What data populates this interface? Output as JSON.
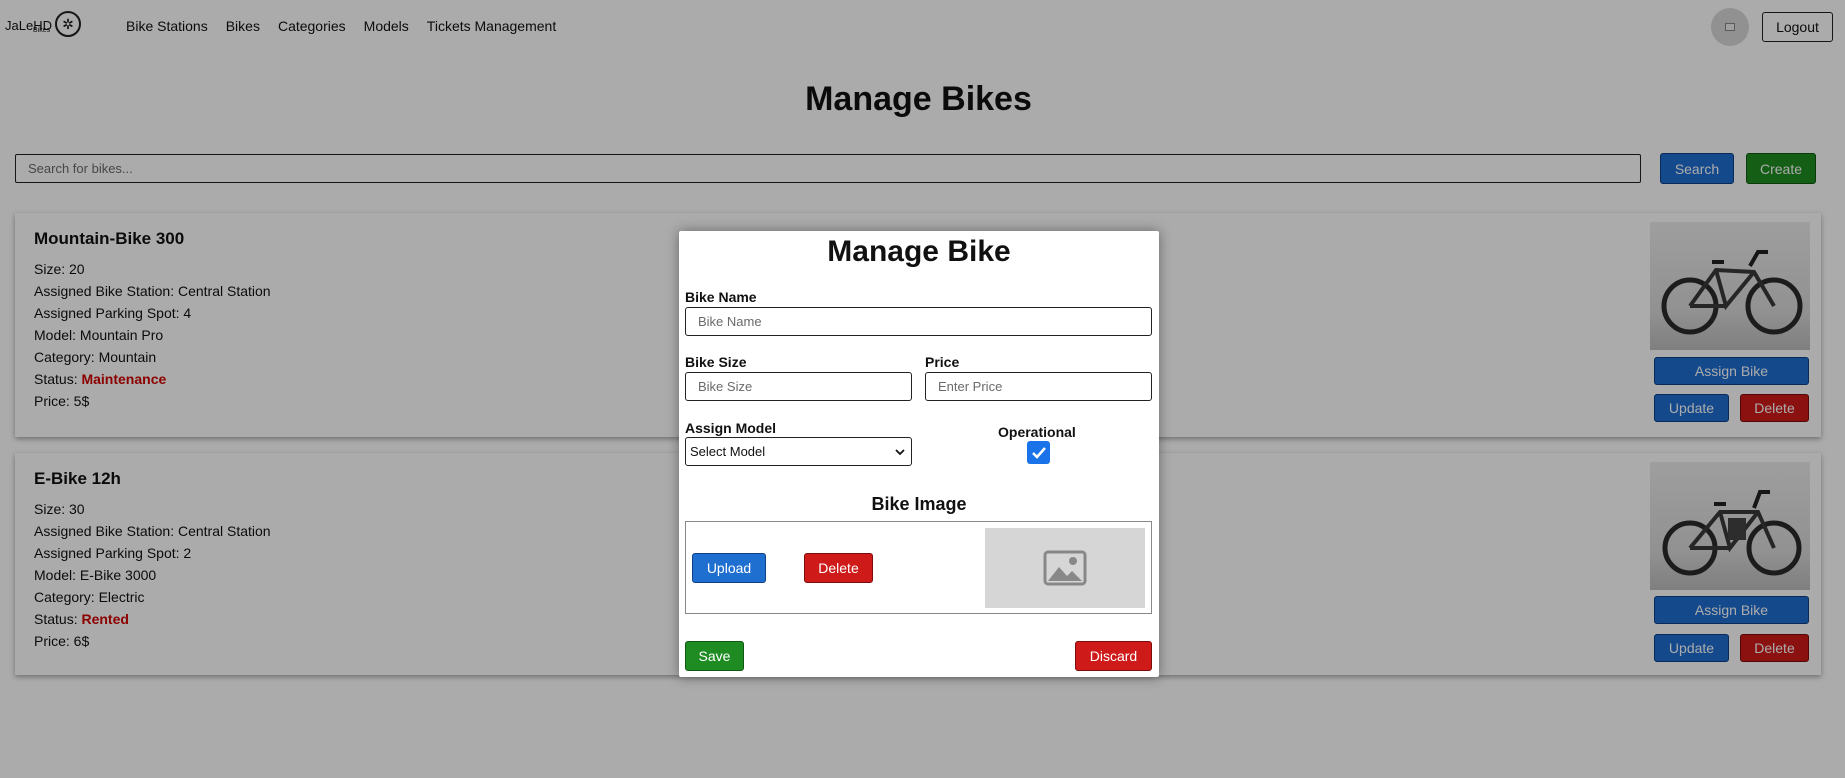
{
  "nav": {
    "logo_text": "JaLeHD",
    "logo_sub": "Bikes",
    "links": [
      "Bike Stations",
      "Bikes",
      "Categories",
      "Models",
      "Tickets Management"
    ],
    "logout": "Logout"
  },
  "page": {
    "title": "Manage Bikes",
    "search_placeholder": "Search for bikes...",
    "search_button": "Search",
    "create_button": "Create"
  },
  "bikes": [
    {
      "name": "Mountain-Bike 300",
      "size": "Size: 20",
      "station": "Assigned Bike Station: Central Station",
      "spot": "Assigned Parking Spot: 4",
      "model": "Model: Mountain Pro",
      "category": "Category: Mountain",
      "status_label": "Status: ",
      "status": "Maintenance",
      "price": "Price: 5$",
      "assign_button": "Assign Bike",
      "update_button": "Update",
      "delete_button": "Delete"
    },
    {
      "name": "E-Bike 12h",
      "size": "Size: 30",
      "station": "Assigned Bike Station: Central Station",
      "spot": "Assigned Parking Spot: 2",
      "model": "Model: E-Bike 3000",
      "category": "Category: Electric",
      "status_label": "Status: ",
      "status": "Rented",
      "price": "Price: 6$",
      "assign_button": "Assign Bike",
      "update_button": "Update",
      "delete_button": "Delete"
    }
  ],
  "modal": {
    "title": "Manage Bike",
    "bike_name_label": "Bike Name",
    "bike_name_placeholder": "Bike Name",
    "bike_size_label": "Bike Size",
    "bike_size_placeholder": "Bike Size",
    "price_label": "Price",
    "price_placeholder": "Enter Price",
    "assign_model_label": "Assign Model",
    "model_selected": "Select Model",
    "operational_label": "Operational",
    "operational_checked": true,
    "image_section_title": "Bike Image",
    "upload_button": "Upload",
    "image_delete_button": "Delete",
    "save_button": "Save",
    "discard_button": "Discard"
  },
  "colors": {
    "primary": "#1f6fd1",
    "success": "#1e8c22",
    "danger": "#cf1a1a",
    "status_text": "#d10000",
    "overlay": "rgba(0,0,0,0.33)"
  },
  "icons": [
    "bike-wheel-icon",
    "avatar-image-icon",
    "image-placeholder-icon",
    "chevron-down-icon",
    "checkmark-icon"
  ]
}
